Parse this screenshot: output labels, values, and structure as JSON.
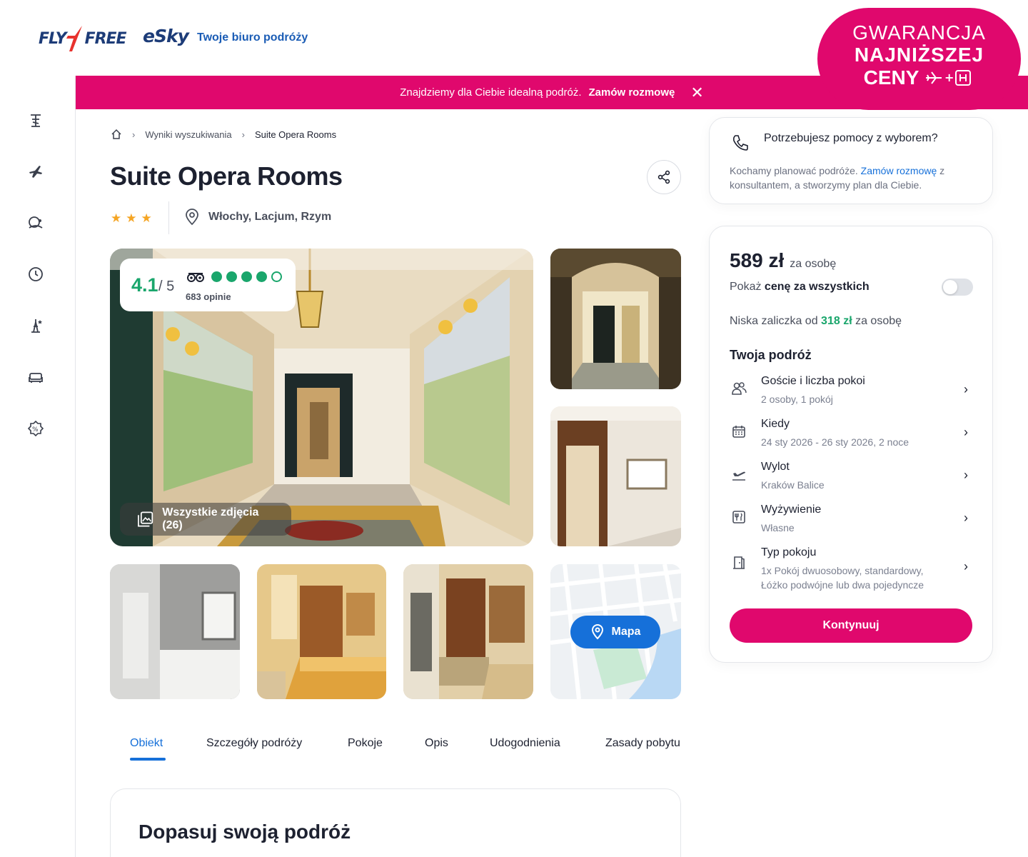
{
  "header": {
    "logo_flyfree_a": "FLY",
    "logo_flyfree_b": "FREE",
    "logo_esky": "eSky",
    "tagline": "Twoje biuro podróży",
    "guarantee": {
      "line1": "GWARANCJA",
      "line2": "NAJNIŻSZEJ",
      "line3": "CENY"
    }
  },
  "promo": {
    "text": "Znajdziemy dla Ciebie idealną podróż.",
    "cta": "Zamów rozmowę"
  },
  "rail": {
    "icons": [
      "beach-umbrella-icon",
      "plane-icon",
      "island-icon",
      "clock-icon",
      "eiffel-tower-icon",
      "sofa-icon",
      "discount-icon"
    ]
  },
  "breadcrumb": {
    "results": "Wyniki wyszukiwania",
    "current": "Suite Opera Rooms"
  },
  "hotel": {
    "name": "Suite Opera Rooms",
    "stars": 3,
    "location": "Włochy, Lacjum, Rzym"
  },
  "rating": {
    "score": "4.1",
    "of": "/ 5",
    "opinions": "683 opinie",
    "filled_dots": 4,
    "total_dots": 5
  },
  "gallery": {
    "all_photos": "Wszystkie zdjęcia (26)",
    "map": "Mapa"
  },
  "tabs": [
    "Obiekt",
    "Szczegóły podróży",
    "Pokoje",
    "Opis",
    "Udogodnienia",
    "Zasady pobytu"
  ],
  "fit": {
    "title": "Dopasuj swoją podróż"
  },
  "help": {
    "title": "Potrzebujesz pomocy z wyborem?",
    "desc_before": "Kochamy planować podróże. ",
    "desc_link": "Zamów rozmowę",
    "desc_after": " z konsultantem, a stworzymy plan dla Ciebie."
  },
  "booking": {
    "price": "589 zł",
    "per_person": "za osobę",
    "show_prefix": "Pokaż ",
    "show_bold": "cenę za wszystkich",
    "deposit_prefix": "Niska zaliczka od ",
    "deposit_amount": "318 zł",
    "deposit_suffix": " za osobę",
    "trip_title": "Twoja podróż",
    "rows": [
      {
        "label": "Goście i liczba pokoi",
        "value": "2 osoby, 1 pokój",
        "icon": "guests-icon"
      },
      {
        "label": "Kiedy",
        "value": "24 sty 2026 - 26 sty 2026, 2 noce",
        "icon": "calendar-icon"
      },
      {
        "label": "Wylot",
        "value": "Kraków Balice",
        "icon": "departure-icon"
      },
      {
        "label": "Wyżywienie",
        "value": "Własne",
        "icon": "meal-icon"
      },
      {
        "label": "Typ pokoju",
        "value": "1x Pokój dwuosobowy, standardowy, Łóżko podwójne lub dwa pojedyncze",
        "icon": "door-icon"
      }
    ],
    "continue": "Kontynuuj"
  },
  "colors": {
    "brand": "#e0086d",
    "accent": "#1670d9",
    "rating": "#1aa66c"
  }
}
